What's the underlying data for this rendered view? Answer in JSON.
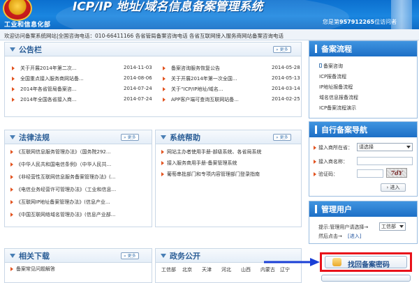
{
  "header": {
    "ministry": "工业和信息化部",
    "site_title": "ICP/IP 地址/域名信息备案管理系统",
    "visitor_prefix": "您是第",
    "visitor_count": "957912265",
    "visitor_suffix": "位访问者"
  },
  "infobar": {
    "text": "欢迎访问备案系统网站|全国咨询电话：010-66411166 各省管局备案咨询电话 各省互联网接入服务商网站备案咨询电话"
  },
  "announcements": {
    "title": "公告栏",
    "more_label": "更多",
    "left": [
      {
        "text": "关于开展2014年第二次...",
        "date": "2014-11-03"
      },
      {
        "text": "全国重点接入服务商网站备...",
        "date": "2014-08-06"
      },
      {
        "text": "2014年各省管局备案咨...",
        "date": "2014-07-24"
      },
      {
        "text": "2014年全国各省接入商...",
        "date": "2014-07-24"
      }
    ],
    "right": [
      {
        "text": "备案咨询服务恢复公告",
        "date": "2014-05-28"
      },
      {
        "text": "关于开展2014年第一次全国...",
        "date": "2014-05-13"
      },
      {
        "text": "关于“ICP/IP地址/域名...",
        "date": "2014-03-14"
      },
      {
        "text": "APP客户端可查询互联网站备...",
        "date": "2014-02-25"
      }
    ]
  },
  "laws": {
    "title": "法律法规",
    "more_label": "更多",
    "items": [
      "《互联网信息服务管理办法》（国务院292...",
      "《中华人民共和国电信条例》（中华人民共...",
      "《非经营性互联网信息服务备案管理办法》(...",
      "《电信业务经营许可管理办法》（工业和信息...",
      "《互联网IP地址备案管理办法》(信息产业...",
      "《中国互联网络域名管理办法》(信息产业部..."
    ]
  },
  "help": {
    "title": "系统帮助",
    "more_label": "更多",
    "items": [
      "网站主办者使用手册-部级系统、各省局系统",
      "接入服务商用手册-备案管理系统",
      "葡萄串批部门和专项内容管理部门登录指南"
    ]
  },
  "downloads": {
    "title": "相关下载",
    "more_label": "更多",
    "items": [
      "备案常见问题解答"
    ]
  },
  "gov": {
    "title": "政务公开",
    "prefix": "工信部",
    "cities": [
      "北京",
      "天津",
      "河北",
      "山西",
      "内蒙古",
      "辽宁"
    ]
  },
  "process": {
    "title": "备案流程",
    "items": [
      "备案咨询",
      "ICP报备流程",
      "IP地址报备流程",
      "域名信息报备流程",
      "ICP备案流程演示"
    ]
  },
  "self_nav": {
    "title": "自行备案导航",
    "province_label": "接入商所在省：",
    "province_value": "请选择",
    "isp_label": "接入商名称：",
    "isp_value": "",
    "captcha_label": "验证码：",
    "captcha_text": "7dY",
    "submit_label": "进入"
  },
  "admin": {
    "title": "管理用户",
    "hint_prefix": "提示:管理用户请选择→",
    "select_value": "工信部",
    "hint_suffix": "然后点击→",
    "enter_label": "[进入]"
  },
  "retrieve": {
    "label": "找回备案密码",
    "highlight_color": "#e8121a",
    "arrow_color": "#1a3fd6"
  },
  "colors": {
    "header_blue": "#1a86e0",
    "panel_title": "#2a5d96",
    "bullet": "#e2531f"
  }
}
